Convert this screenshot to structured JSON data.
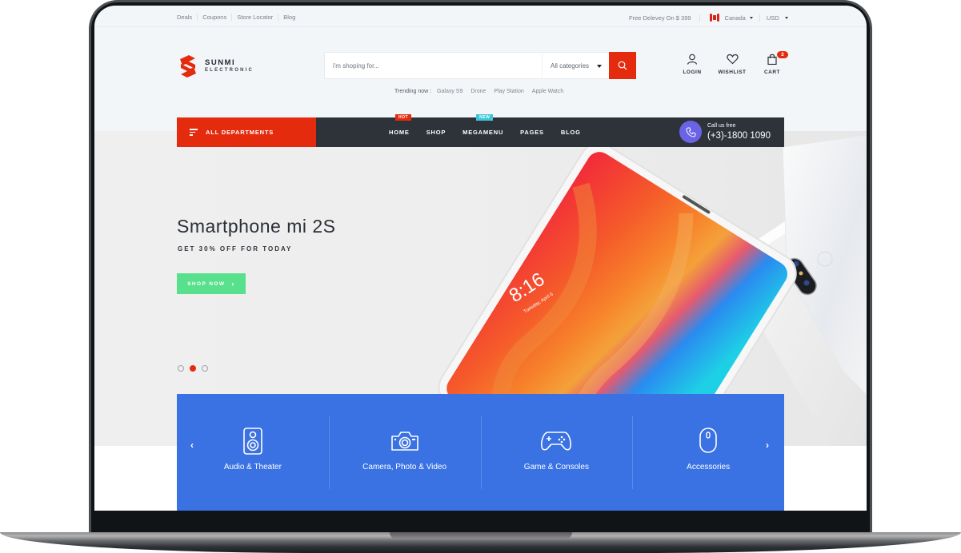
{
  "topbar": {
    "links": [
      "Deals",
      "Coupons",
      "Store Locator",
      "Blog"
    ],
    "shipping_note": "Free Delevey On $ 399",
    "country": "Canada",
    "currency": "USD"
  },
  "brand": {
    "name": "SUNMI",
    "tagline": "ELECTRONIC",
    "color": "#e42b0e"
  },
  "search": {
    "placeholder": "i'm shoping for...",
    "category": "All categories",
    "trending_label": "Trending now :",
    "trending": [
      "Galaxy S9",
      "Drone",
      "Play Station",
      "Apple Watch"
    ]
  },
  "header_icons": {
    "login": "LOGIN",
    "wishlist": "WISHLIST",
    "cart": "CART",
    "cart_count": "3"
  },
  "nav": {
    "departments": "ALL DEPARTMENTS",
    "items": [
      {
        "label": "HOME",
        "tag": "HOT"
      },
      {
        "label": "SHOP"
      },
      {
        "label": "MEGAMENU",
        "tag": "NEW"
      },
      {
        "label": "PAGES"
      },
      {
        "label": "BLOG"
      }
    ],
    "call_label": "Call us free",
    "call_number": "(+3)-1800 1090"
  },
  "hero": {
    "title": "Smartphone mi 2S",
    "subtitle": "GET 30% OFF FOR TODAY",
    "cta": "SHOP NOW",
    "cta_arrow": "›",
    "phone_time": "8:16",
    "phone_date": "Tuesday, April 6",
    "slides": 3,
    "active_slide": 2
  },
  "categories": {
    "prev": "‹",
    "next": "›",
    "items": [
      {
        "label": "Audio & Theater",
        "icon": "speaker-icon"
      },
      {
        "label": "Camera, Photo & Video",
        "icon": "camera-icon"
      },
      {
        "label": "Game & Consoles",
        "icon": "gamepad-icon"
      },
      {
        "label": "Accessories",
        "icon": "mouse-icon"
      }
    ]
  },
  "colors": {
    "accent": "#e42b0e",
    "nav_dark": "#2d3339",
    "cta_green": "#58e08c",
    "category_blue": "#3a71e3",
    "call_purple": "#6a63e6"
  }
}
